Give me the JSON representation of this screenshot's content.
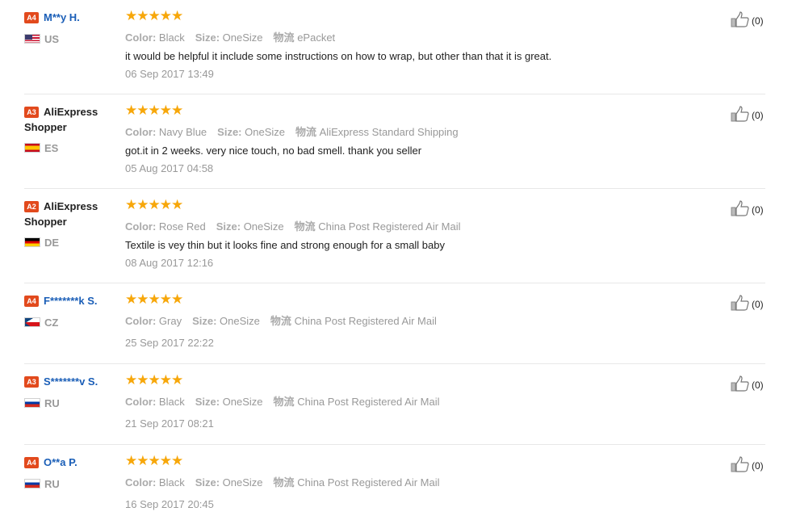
{
  "labels": {
    "color": "Color:",
    "size": "Size:",
    "shipping": "物流"
  },
  "reviews": [
    {
      "level": "A4",
      "name": "M**y H.",
      "country": "US",
      "stars": "★★★★★",
      "color": "Black",
      "size": "OneSize",
      "shipping": "ePacket",
      "text": "it would be helpful it include some instructions on how to wrap, but other than that it is great.",
      "date": "06 Sep 2017 13:49",
      "likes": "(0)"
    },
    {
      "level": "A3",
      "name": "AliExpress Shopper",
      "country": "ES",
      "stars": "★★★★★",
      "color": "Navy Blue",
      "size": "OneSize",
      "shipping": "AliExpress Standard Shipping",
      "text": "got.it in 2 weeks. very nice touch, no bad smell. thank you seller",
      "date": "05 Aug 2017 04:58",
      "likes": "(0)"
    },
    {
      "level": "A2",
      "name": "AliExpress Shopper",
      "country": "DE",
      "stars": "★★★★★",
      "color": "Rose Red",
      "size": "OneSize",
      "shipping": "China Post Registered Air Mail",
      "text": "Textile is vey thin but it looks fine and strong enough for a small baby",
      "date": "08 Aug 2017 12:16",
      "likes": "(0)"
    },
    {
      "level": "A4",
      "name": "F*******k S.",
      "country": "CZ",
      "stars": "★★★★★",
      "color": "Gray",
      "size": "OneSize",
      "shipping": "China Post Registered Air Mail",
      "text": "",
      "date": "25 Sep 2017 22:22",
      "likes": "(0)"
    },
    {
      "level": "A3",
      "name": "S*******v S.",
      "country": "RU",
      "stars": "★★★★★",
      "color": "Black",
      "size": "OneSize",
      "shipping": "China Post Registered Air Mail",
      "text": "",
      "date": "21 Sep 2017 08:21",
      "likes": "(0)"
    },
    {
      "level": "A4",
      "name": "O**a P.",
      "country": "RU",
      "stars": "★★★★★",
      "color": "Black",
      "size": "OneSize",
      "shipping": "China Post Registered Air Mail",
      "text": "",
      "date": "16 Sep 2017 20:45",
      "likes": "(0)"
    }
  ],
  "rating": {
    "value": 5,
    "max": 5
  },
  "colors": {
    "level_badge": "#e24a1d",
    "star": "#f7a70a",
    "link_name": "#1a5eb7",
    "muted": "#999999",
    "divider": "#e8e8e8"
  },
  "icons": {
    "helpful": "thumbs-up-icon"
  }
}
